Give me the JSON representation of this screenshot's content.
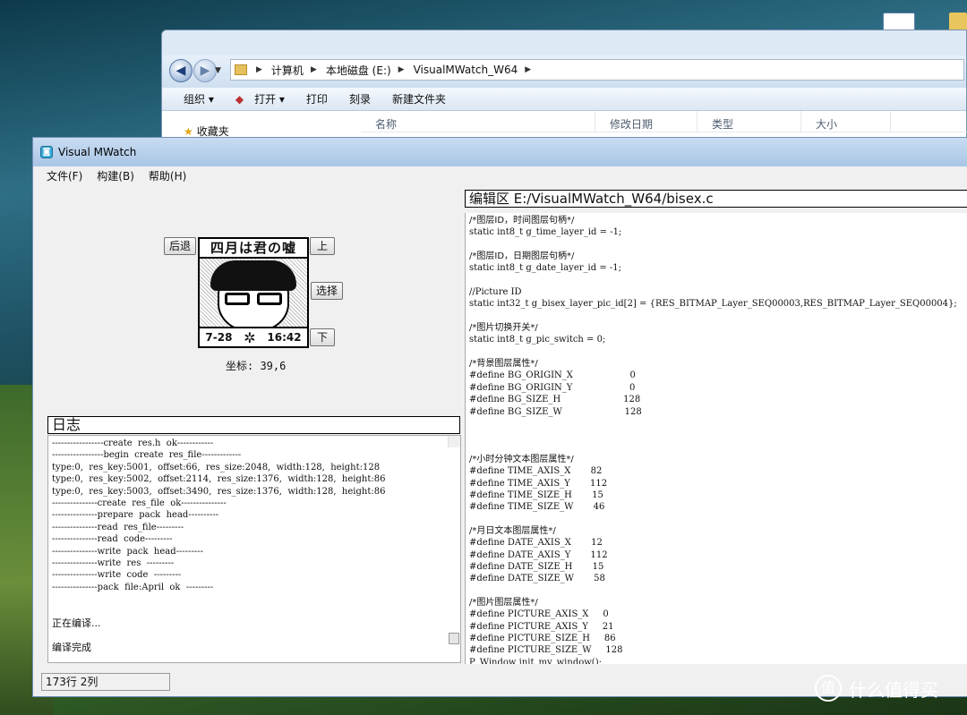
{
  "explorer": {
    "breadcrumb": [
      "计算机",
      "本地磁盘 (E:)",
      "VisualMWatch_W64"
    ],
    "toolbar": [
      "组织 ▾",
      "打开 ▾",
      "打印",
      "刻录",
      "新建文件夹"
    ],
    "favorites": "收藏夹",
    "columns": [
      "名称",
      "修改日期",
      "类型",
      "大小"
    ]
  },
  "app": {
    "title": "Visual MWatch",
    "menu": [
      "文件(F)",
      "构建(B)",
      "帮助(H)"
    ]
  },
  "simulator": {
    "back_label": "后退",
    "up_label": "上",
    "select_label": "选择",
    "down_label": "下",
    "screen_title": "四月は君の嘘",
    "screen_date": "7-28",
    "screen_time": "16:42",
    "screen_sep": "✲",
    "coords": "坐标: 39,6"
  },
  "log": {
    "header": "日志",
    "lines": [
      "-----------------create  res.h  ok------------",
      "-----------------begin  create  res_file-------------",
      "type:0,  res_key:5001,  offset:66,  res_size:2048,  width:128,  height:128",
      "type:0,  res_key:5002,  offset:2114,  res_size:1376,  width:128,  height:86",
      "type:0,  res_key:5003,  offset:3490,  res_size:1376,  width:128,  height:86",
      "---------------create  res_file  ok---------------",
      "---------------prepare  pack  head----------",
      "---------------read  res_file---------",
      "---------------read  code---------",
      "---------------write  pack  head---------",
      "---------------write  res  ---------",
      "---------------write  code  ---------",
      "---------------pack  file:April  ok  ---------",
      "",
      "",
      "正在编译...",
      "",
      "编译完成"
    ]
  },
  "editor": {
    "header": "编辑区  E:/VisualMWatch_W64/bisex.c",
    "lines": [
      "/*图层ID，时间图层句柄*/",
      "static int8_t g_time_layer_id = -1;",
      "",
      "/*图层ID，日期图层句柄*/",
      "static int8_t g_date_layer_id = -1;",
      "",
      "//Picture ID",
      "static int32_t g_bisex_layer_pic_id[2] = {RES_BITMAP_Layer_SEQ00003,RES_BITMAP_Layer_SEQ00004};",
      "",
      "/*图片切换开关*/",
      "static int8_t g_pic_switch = 0;",
      "",
      "/*背景图层属性*/",
      "#define BG_ORIGIN_X                    0",
      "#define BG_ORIGIN_Y                    0",
      "#define BG_SIZE_H                      128",
      "#define BG_SIZE_W                      128",
      "",
      "",
      "",
      "/*小时分钟文本图层属性*/",
      "#define TIME_AXIS_X       82",
      "#define TIME_AXIS_Y       112",
      "#define TIME_SIZE_H       15",
      "#define TIME_SIZE_W       46",
      "",
      "/*月日文本图层属性*/",
      "#define DATE_AXIS_X       12",
      "#define DATE_AXIS_Y       112",
      "#define DATE_SIZE_H       15",
      "#define DATE_SIZE_W       58",
      "",
      "/*图片图层属性*/",
      "#define PICTURE_AXIS_X     0",
      "#define PICTURE_AXIS_Y     21",
      "#define PICTURE_SIZE_H     86",
      "#define PICTURE_SIZE_W     128",
      "P_Window init_my_window();"
    ]
  },
  "status": "173行 2列",
  "watermark": "什么值得买"
}
